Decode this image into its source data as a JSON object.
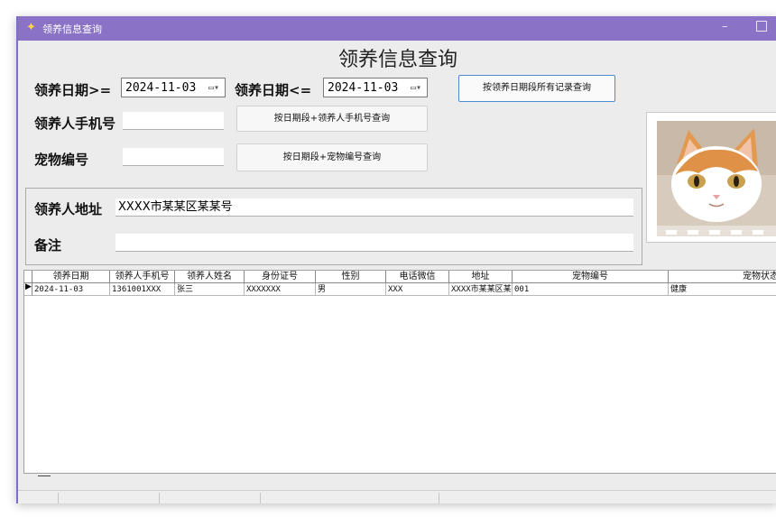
{
  "window": {
    "title": "领养信息查询"
  },
  "heading": "领养信息查询",
  "form": {
    "date_from_label": "领养日期>=",
    "date_from_value": "2024-11-03",
    "date_to_label": "领养日期<=",
    "date_to_value": "2024-11-03",
    "btn_all_label": "按领养日期段所有记录查询",
    "phone_label": "领养人手机号",
    "phone_value": "",
    "btn_phone_label": "按日期段+领养人手机号查询",
    "pet_label": "宠物编号",
    "pet_value": "",
    "btn_pet_label": "按日期段+宠物编号查询",
    "address_label": "领养人地址",
    "address_value": "XXXX市某某区某某号",
    "note_label": "备注",
    "note_value": ""
  },
  "grid": {
    "columns": [
      "领养日期",
      "领养人手机号",
      "领养人姓名",
      "身份证号",
      "性别",
      "电话微信",
      "地址",
      "宠物编号",
      "宠物状态"
    ],
    "rows": [
      [
        "2024-11-03",
        "1361001XXX",
        "张三",
        "XXXXXXX",
        "男",
        "XXX",
        "XXXX市某某区某",
        "001",
        "健康"
      ]
    ]
  },
  "colors": {
    "titlebar": "#8a72c6",
    "accent": "#4d8ad6"
  },
  "icons": {
    "app": "app-logo-icon",
    "minimize": "minimize-icon",
    "maximize": "maximize-icon",
    "dropdown": "calendar-dropdown-icon",
    "row_pointer": "row-pointer-icon"
  }
}
